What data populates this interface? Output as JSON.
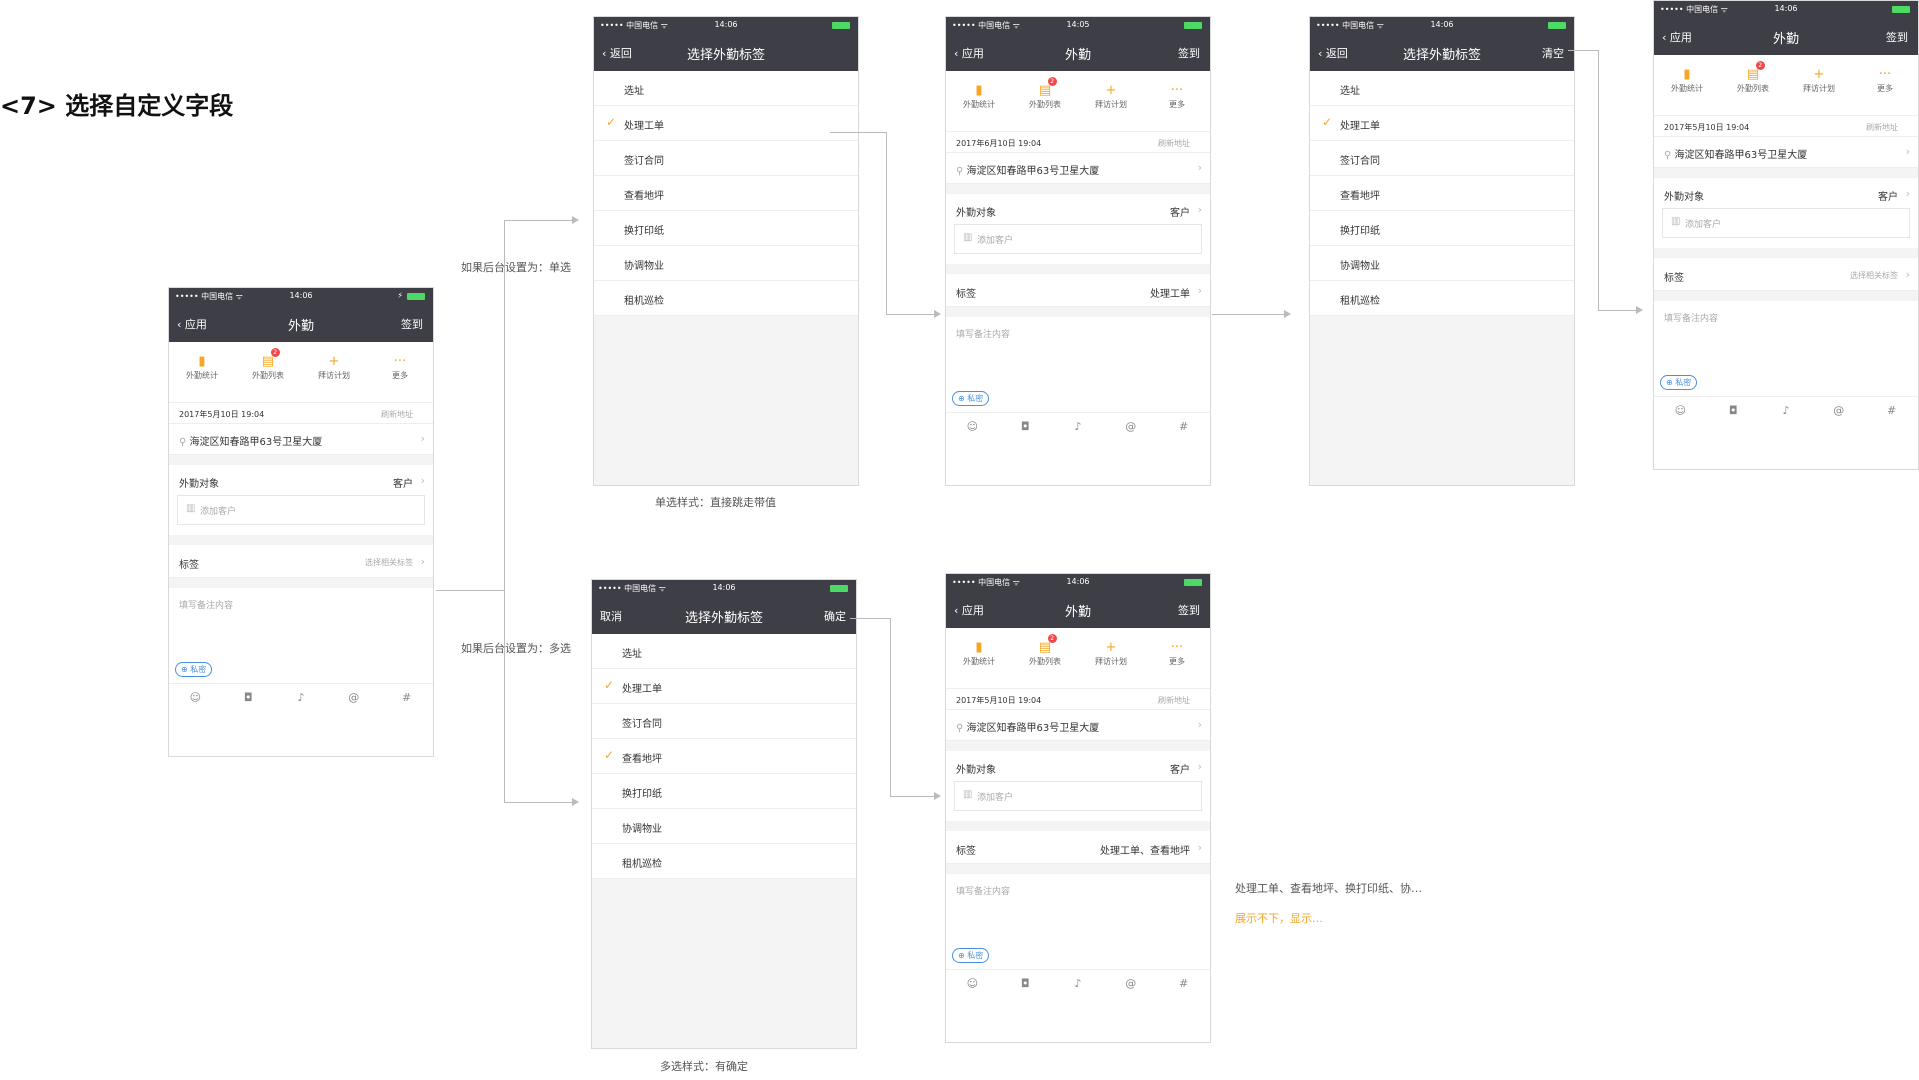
{
  "page_title": "<7> 选择自定义字段",
  "status": {
    "carrier": "••••• 中国电信 ᯤ",
    "time1": "14:06",
    "time2": "14:05"
  },
  "nav": {
    "back_app": "应用",
    "back": "返回",
    "title_main": "外勤",
    "title_pick": "选择外勤标签",
    "sign": "签到",
    "clear": "清空",
    "cancel": "取消",
    "confirm": "确定"
  },
  "toolbar": [
    {
      "label": "外勤统计",
      "icon": "bar-chart-icon"
    },
    {
      "label": "外勤列表",
      "icon": "list-icon",
      "badge": "2"
    },
    {
      "label": "拜访计划",
      "icon": "plus-icon"
    },
    {
      "label": "更多",
      "icon": "more-icon"
    }
  ],
  "checkin": {
    "datetime": "2017年5月10日 19:04",
    "datetime_alt": "2017年6月10日 19:04",
    "refresh": "刷新地址",
    "address": "海淀区知春路甲63号卫星大厦"
  },
  "fields": {
    "target_label": "外勤对象",
    "target_value": "客户",
    "add_customer": "添加客户",
    "tag_label": "标签",
    "tag_placeholder": "选择相关标签",
    "tag_single": "处理工单",
    "tag_multi": "处理工单、查看地坪",
    "memo_placeholder": "填写备注内容",
    "privacy": "私密"
  },
  "options": [
    "选址",
    "处理工单",
    "签订合同",
    "查看地坪",
    "换打印纸",
    "协调物业",
    "租机巡检"
  ],
  "notes": {
    "single_branch": "如果后台设置为：单选",
    "multi_branch": "如果后台设置为：多选",
    "single_caption": "单选样式：直接跳走带值",
    "multi_caption": "多选样式：有确定",
    "overflow_value": "处理工单、查看地坪、换打印纸、协…",
    "overflow_hint": "展示不下，显示…"
  },
  "bottom_icons": [
    "emoji-icon",
    "camera-icon",
    "mic-icon",
    "mention-icon",
    "hashtag-icon"
  ]
}
